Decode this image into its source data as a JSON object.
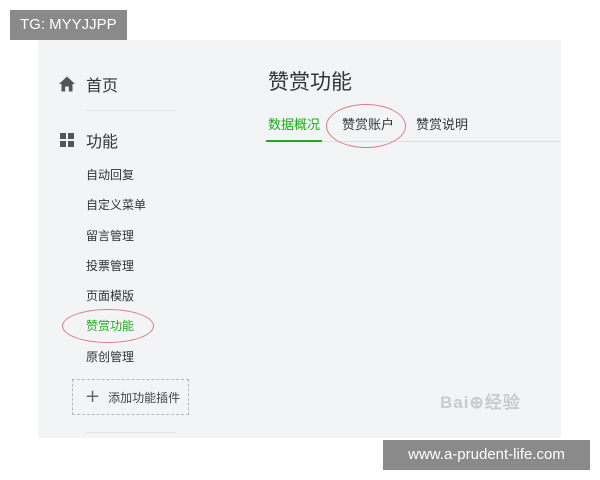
{
  "overlay": {
    "tg_label": "TG: MYYJJPP",
    "site_watermark": "www.a-prudent-life.com",
    "baidu_watermark": "Bai⊕经验"
  },
  "sidebar": {
    "home_label": "首页",
    "home_icon": "home-icon",
    "function_label": "功能",
    "function_icon": "grid-icon",
    "items": [
      {
        "label": "自动回复",
        "active": false
      },
      {
        "label": "自定义菜单",
        "active": false
      },
      {
        "label": "留言管理",
        "active": false
      },
      {
        "label": "投票管理",
        "active": false
      },
      {
        "label": "页面模版",
        "active": false
      },
      {
        "label": "赞赏功能",
        "active": true
      },
      {
        "label": "原创管理",
        "active": false
      }
    ],
    "add_plugin_label": "添加功能插件"
  },
  "main": {
    "title": "赞赏功能",
    "tabs": [
      {
        "label": "数据概况",
        "active": true
      },
      {
        "label": "赞赏账户",
        "active": false
      },
      {
        "label": "赞赏说明",
        "active": false
      }
    ]
  },
  "colors": {
    "accent": "#1aad19",
    "annotation": "#d87f86",
    "panel_bg": "#f3f4f6"
  }
}
